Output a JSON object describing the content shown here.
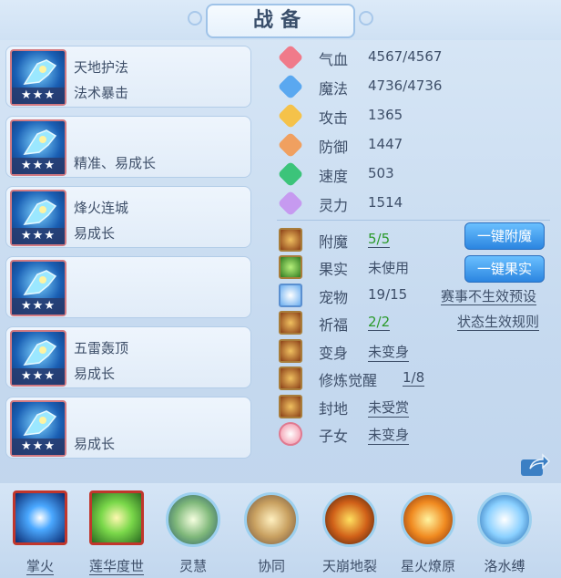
{
  "title": "战备",
  "equipment": [
    {
      "line1": "天地护法",
      "line2": "法术暴击",
      "stars": "★★★"
    },
    {
      "line1": "",
      "line2": "精准、易成长",
      "stars": "★★★"
    },
    {
      "line1": "烽火连城",
      "line2": "易成长",
      "stars": "★★★"
    },
    {
      "line1": "",
      "line2": "",
      "stars": "★★★"
    },
    {
      "line1": "五雷轰顶",
      "line2": "易成长",
      "stars": "★★★"
    },
    {
      "line1": "",
      "line2": "易成长",
      "stars": "★★★"
    }
  ],
  "stats": [
    {
      "label": "气血",
      "value": "4567/4567",
      "icon": "heart-icon",
      "color": "#f07a8a"
    },
    {
      "label": "魔法",
      "value": "4736/4736",
      "icon": "mana-icon",
      "color": "#5aa8f0"
    },
    {
      "label": "攻击",
      "value": "1365",
      "icon": "sword-icon",
      "color": "#f5c24a"
    },
    {
      "label": "防御",
      "value": "1447",
      "icon": "shield-icon",
      "color": "#f0a060"
    },
    {
      "label": "速度",
      "value": "503",
      "icon": "speed-icon",
      "color": "#3cc47a"
    },
    {
      "label": "灵力",
      "value": "1514",
      "icon": "spirit-icon",
      "color": "#c69af0"
    }
  ],
  "extras": [
    {
      "label": "附魔",
      "value": "5/5",
      "icon": "enchant-icon"
    },
    {
      "label": "果实",
      "value": "未使用",
      "icon": "fruit-icon"
    },
    {
      "label": "宠物",
      "value": "19/15",
      "icon": "pet-icon"
    },
    {
      "label": "祈福",
      "value": "2/2",
      "icon": "blessing-icon"
    },
    {
      "label": "变身",
      "value": "未变身",
      "icon": "transform-icon"
    },
    {
      "label": "修炼觉醒",
      "value": "1/8",
      "icon": "cultivation-icon"
    },
    {
      "label": "封地",
      "value": "未受赏",
      "icon": "fief-icon"
    },
    {
      "label": "子女",
      "value": "未变身",
      "icon": "child-icon"
    }
  ],
  "buttons": {
    "enchant": "一键附魔",
    "fruit": "一键果实"
  },
  "links": {
    "tournament": "赛事不生效预设",
    "status_rules": "状态生效规则"
  },
  "skills": [
    {
      "label": "掌火",
      "icon": "palm-fire-icon"
    },
    {
      "label": "莲华度世",
      "icon": "lotus-hand-icon"
    },
    {
      "label": "灵慧",
      "icon": "wisdom-icon"
    },
    {
      "label": "协同",
      "icon": "synergy-icon"
    },
    {
      "label": "天崩地裂",
      "icon": "earthquake-icon"
    },
    {
      "label": "星火燎原",
      "icon": "prairie-fire-icon"
    },
    {
      "label": "洛水缚",
      "icon": "water-bind-icon"
    }
  ]
}
